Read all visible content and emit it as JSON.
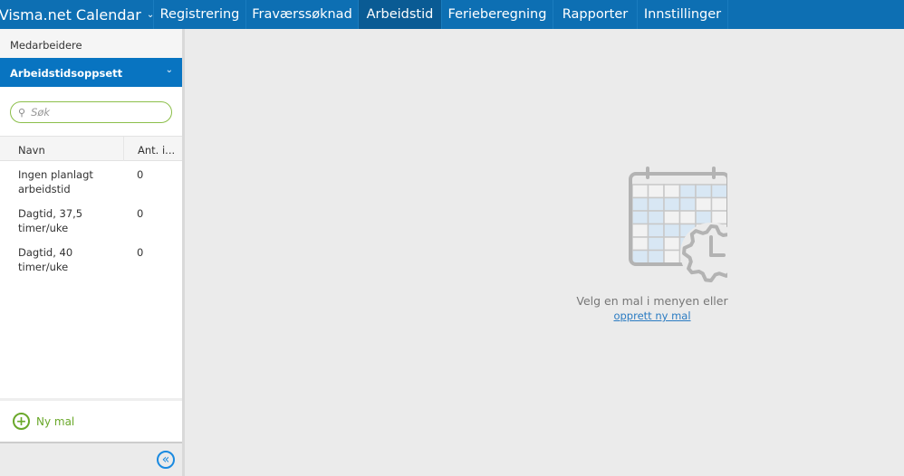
{
  "topnav": {
    "brand": "Visma.net Calendar",
    "items": [
      "Registrering",
      "Fraværssøknad",
      "Arbeidstid",
      "Ferieberegning",
      "Rapporter",
      "Innstillinger"
    ],
    "active": "Arbeidstid"
  },
  "sidebar": {
    "section1": "Medarbeidere",
    "section2": "Arbeidstidsoppsett",
    "search_placeholder": "Søk",
    "columns": [
      "Navn",
      "Ant. i..."
    ],
    "rows": [
      {
        "name": "Ingen planlagt arbeidstid",
        "count": "0"
      },
      {
        "name": "Dagtid, 37,5 timer/uke",
        "count": "0"
      },
      {
        "name": "Dagtid, 40 timer/uke",
        "count": "0"
      }
    ],
    "new_label": "Ny mal"
  },
  "main": {
    "message": "Velg en mal i menyen eller",
    "link": "opprett ny mal"
  },
  "colors": {
    "nav": "#0d6fb3",
    "nav_active": "#0a5b94",
    "accent_green": "#6aa82a",
    "link": "#2a7bc2"
  }
}
